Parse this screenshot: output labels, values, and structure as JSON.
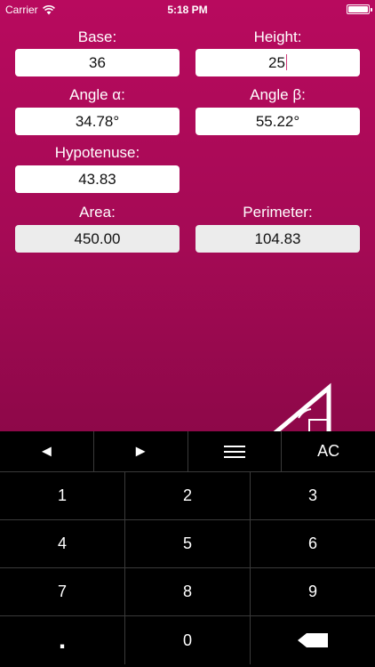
{
  "status_bar": {
    "carrier": "Carrier",
    "time": "5:18 PM"
  },
  "form": {
    "base": {
      "label": "Base:",
      "value": "36"
    },
    "height": {
      "label": "Height:",
      "value": "25"
    },
    "angle_a": {
      "label": "Angle α:",
      "value": "34.78°"
    },
    "angle_b": {
      "label": "Angle β:",
      "value": "55.22°"
    },
    "hypotenuse": {
      "label": "Hypotenuse:",
      "value": "43.83"
    },
    "area": {
      "label": "Area:",
      "value": "450.00"
    },
    "perimeter": {
      "label": "Perimeter:",
      "value": "104.83"
    }
  },
  "keyboard": {
    "left_arrow": "◄",
    "right_arrow": "►",
    "menu_icon": "menu-icon",
    "clear": "AC",
    "digits": [
      "1",
      "2",
      "3",
      "4",
      "5",
      "6",
      "7",
      "8",
      "9",
      "0"
    ],
    "decimal": ".",
    "backspace_icon": "backspace-icon"
  },
  "colors": {
    "background_top": "#b80a5e",
    "background_bottom": "#8e0849",
    "keyboard": "#000000"
  }
}
